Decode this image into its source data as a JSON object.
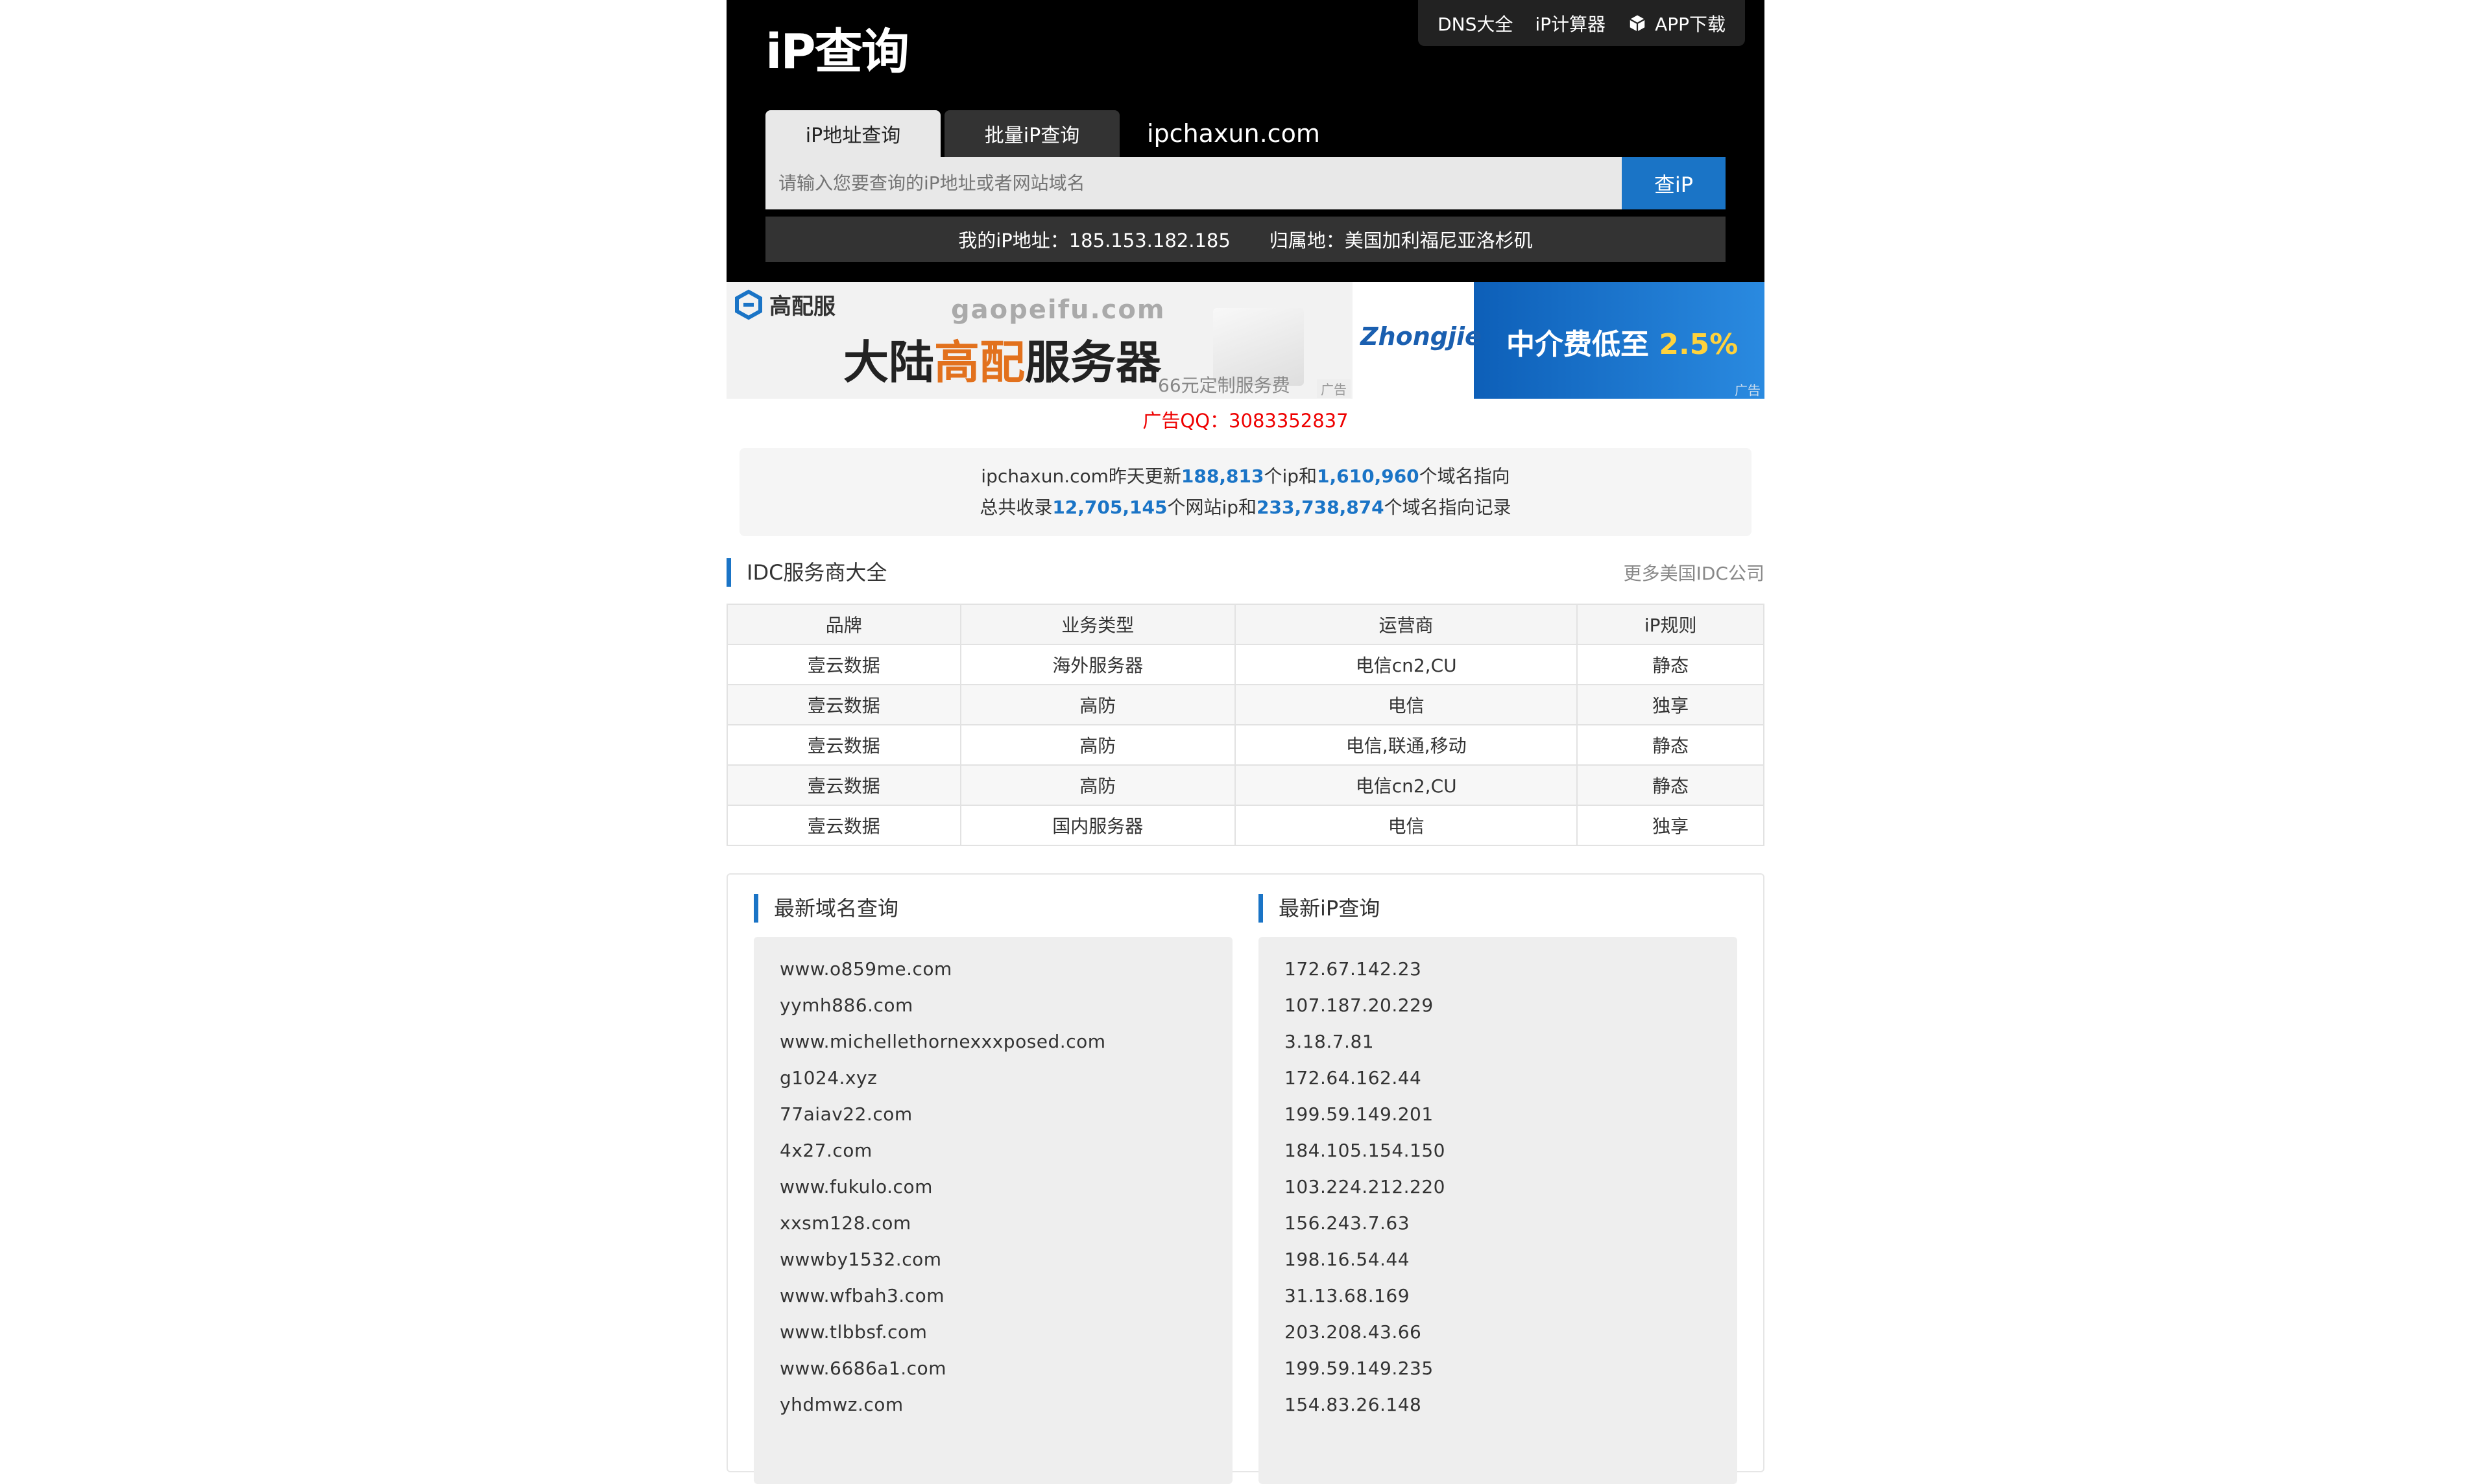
{
  "header": {
    "logo": "iP查询",
    "top_links": {
      "dns": "DNS大全",
      "calc": "iP计算器",
      "app": "APP下载"
    },
    "tabs": [
      {
        "label": "iP地址查询"
      },
      {
        "label": "批量iP查询"
      }
    ],
    "domain": "ipchaxun.com",
    "search": {
      "placeholder": "请输入您要查询的iP地址或者网站域名",
      "button": "查iP"
    },
    "my_ip": {
      "ip_text": "我的iP地址：185.153.182.185",
      "loc_text": "归属地：美国加利福尼亚洛杉矶"
    }
  },
  "ad": {
    "brand": "高配服",
    "domain": "gaopeifu.com",
    "headline_pre": "大陆",
    "headline_hl": "高配",
    "headline_post": "服务器",
    "fee": "66元定制服务费",
    "tag": "广告",
    "zj_logo": "Zhongjie",
    "zj_pre": "中介费低至 ",
    "zj_pct": "2.5%",
    "qq": "广告QQ：3083352837"
  },
  "stats": {
    "l1_a": "ipchaxun.com昨天更新",
    "l1_n1": "188,813",
    "l1_b": "个ip和",
    "l1_n2": "1,610,960",
    "l1_c": "个域名指向",
    "l2_a": "总共收录",
    "l2_n1": "12,705,145",
    "l2_b": "个网站ip和",
    "l2_n2": "233,738,874",
    "l2_c": "个域名指向记录"
  },
  "idc": {
    "title": "IDC服务商大全",
    "more": "更多美国IDC公司",
    "headers": [
      "品牌",
      "业务类型",
      "运营商",
      "iP规则"
    ],
    "rows": [
      [
        "壹云数据",
        "海外服务器",
        "电信cn2,CU",
        "静态"
      ],
      [
        "壹云数据",
        "高防",
        "电信",
        "独享"
      ],
      [
        "壹云数据",
        "高防",
        "电信,联通,移动",
        "静态"
      ],
      [
        "壹云数据",
        "高防",
        "电信cn2,CU",
        "静态"
      ],
      [
        "壹云数据",
        "国内服务器",
        "电信",
        "独享"
      ]
    ]
  },
  "latest_domains": {
    "title": "最新域名查询",
    "items": [
      "www.o859me.com",
      "yymh886.com",
      "www.michellethornexxxposed.com",
      "g1024.xyz",
      "77aiav22.com",
      "4x27.com",
      "www.fukulo.com",
      "xxsm128.com",
      "wwwby1532.com",
      "www.wfbah3.com",
      "www.tlbbsf.com",
      "www.6686a1.com",
      "yhdmwz.com"
    ]
  },
  "latest_ips": {
    "title": "最新iP查询",
    "items": [
      "172.67.142.23",
      "107.187.20.229",
      "3.18.7.81",
      "172.64.162.44",
      "199.59.149.201",
      "184.105.154.150",
      "103.224.212.220",
      "156.243.7.63",
      "198.16.54.44",
      "31.13.68.169",
      "203.208.43.66",
      "199.59.149.235",
      "154.83.26.148"
    ]
  },
  "colors": {
    "accent": "#1a74c6",
    "header_bg": "#000000",
    "ad_qq": "#ee0000"
  }
}
